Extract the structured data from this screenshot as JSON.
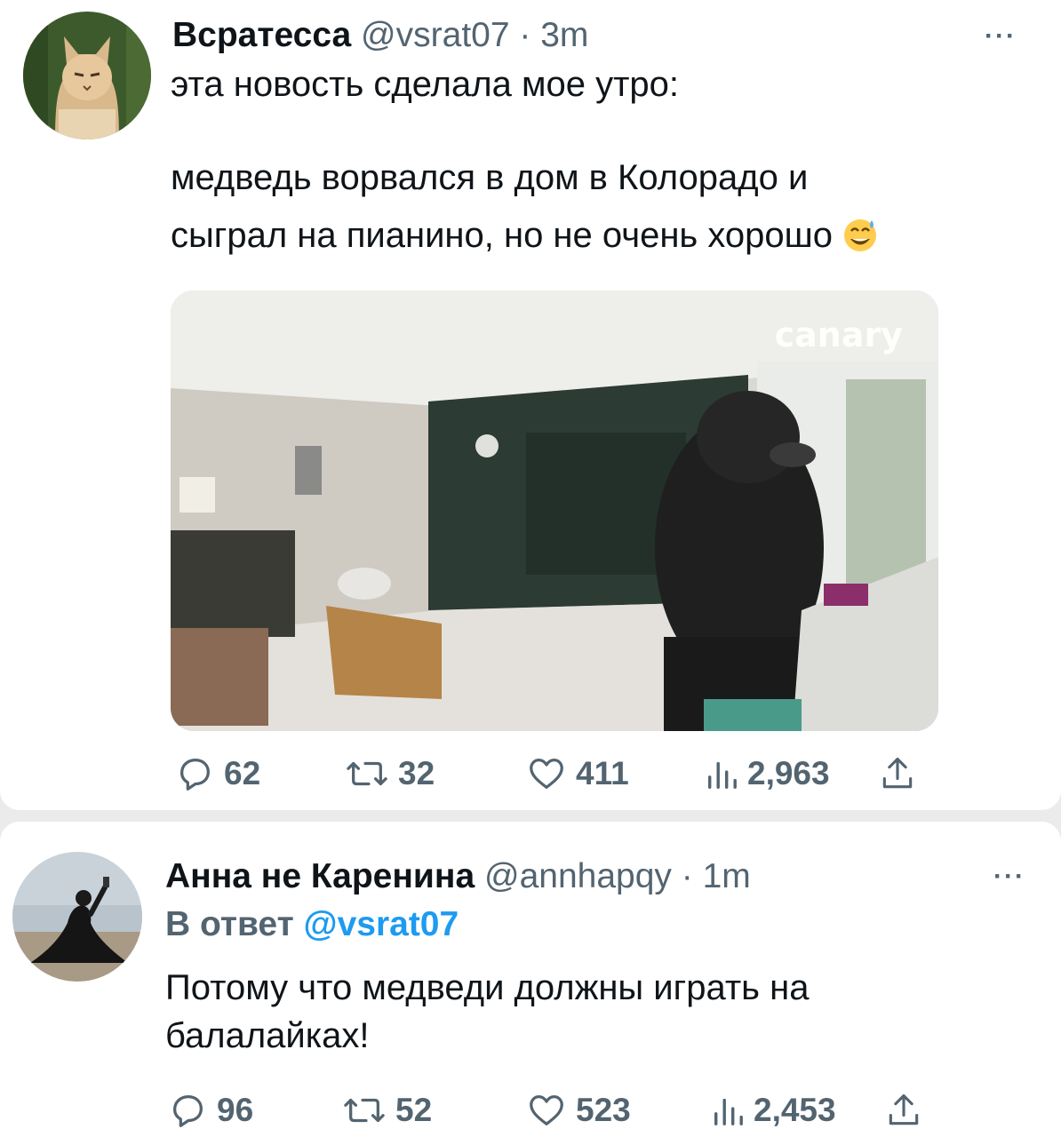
{
  "tweet1": {
    "name": "Всратесса",
    "handle": "@vsrat07",
    "time": "3m",
    "more": "···",
    "text_line1": "эта новость сделала мое утро:",
    "text_line2": "медведь ворвался в дом в Колорадо и",
    "text_line3": "сыграл на пианино, но не очень хорошо",
    "emoji": "sweat-smile-emoji",
    "media_watermark": "canary",
    "replies": "62",
    "retweets": "32",
    "likes": "411",
    "views": "2,963"
  },
  "tweet2": {
    "name": "Анна не Каренина",
    "handle": "@annhapqy",
    "time": "1m",
    "more": "···",
    "reply_prefix": "В ответ",
    "reply_handle": "@vsrat07",
    "text_line1": "Потому что медведи должны играть на",
    "text_line2": "балалайках!",
    "replies": "96",
    "retweets": "52",
    "likes": "523",
    "views": "2,453"
  },
  "icons": {
    "reply": "reply-icon",
    "retweet": "retweet-icon",
    "like": "heart-icon",
    "views": "views-icon",
    "share": "share-icon"
  },
  "colors": {
    "text": "#0f1419",
    "muted": "#536471",
    "link": "#1d9bf0"
  }
}
